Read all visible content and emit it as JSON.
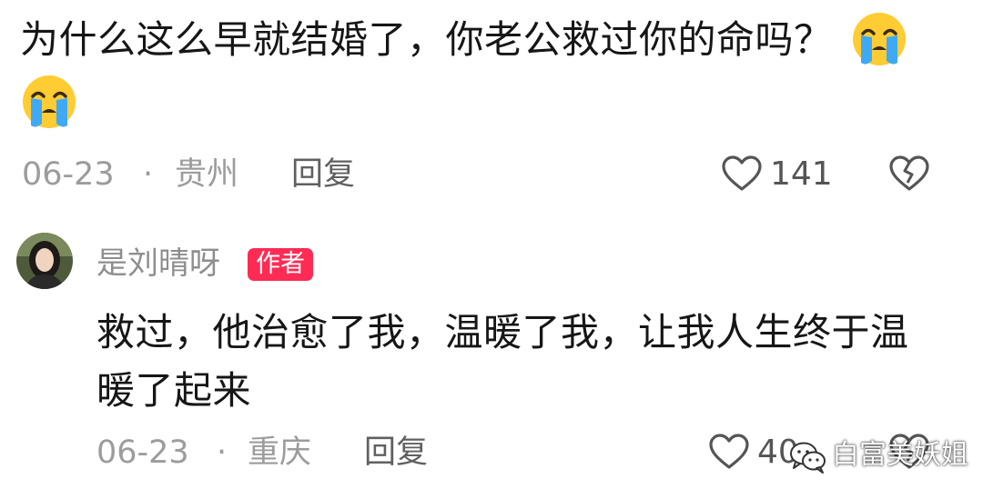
{
  "comment": {
    "text": "为什么这么早就结婚了，你老公救过你的命吗？",
    "emoji_icon": "loudly-crying-face-icon",
    "date": "06-23",
    "separator": "·",
    "location": "贵州",
    "reply_label": "回复",
    "like_count": "141",
    "like_icon": "heart-outline-icon",
    "dislike_icon": "broken-heart-icon"
  },
  "reply": {
    "username": "是刘晴呀",
    "badge": "作者",
    "avatar_icon": "user-avatar-photo",
    "text_line1": "救过，他治愈了我，温暖了我，让我人生终于温",
    "text_line2": "暖了起来",
    "date": "06-23",
    "separator": "·",
    "location": "重庆",
    "reply_label": "回复",
    "like_count": "40",
    "like_icon": "heart-outline-icon",
    "dislike_icon": "broken-heart-icon"
  },
  "watermark": {
    "icon": "wechat-icon",
    "text": "白富美妖姐"
  },
  "colors": {
    "badge": "#fe2c55",
    "main_text": "#161616",
    "meta_text": "#9c9c9c"
  }
}
